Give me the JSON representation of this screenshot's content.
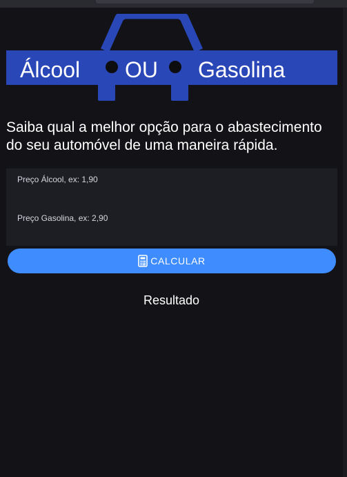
{
  "brand": {
    "logo_word_left": "Álcool",
    "logo_word_middle": "OU",
    "logo_word_right": "Gasolina",
    "logo_color": "#2a47b8"
  },
  "intro": {
    "tagline": "Saiba qual a melhor opção para o abastecimento do seu automóvel de uma maneira rápida."
  },
  "form": {
    "alcohol_label": "Preço Álcool, ex: 1,90",
    "alcohol_value": "",
    "gas_label": "Preço Gasolina, ex: 2,90",
    "gas_value": ""
  },
  "actions": {
    "calculate_label": "CALCULAR",
    "calculate_icon": "calculator-icon",
    "button_color": "#3f8cff"
  },
  "result": {
    "label": "Resultado"
  }
}
